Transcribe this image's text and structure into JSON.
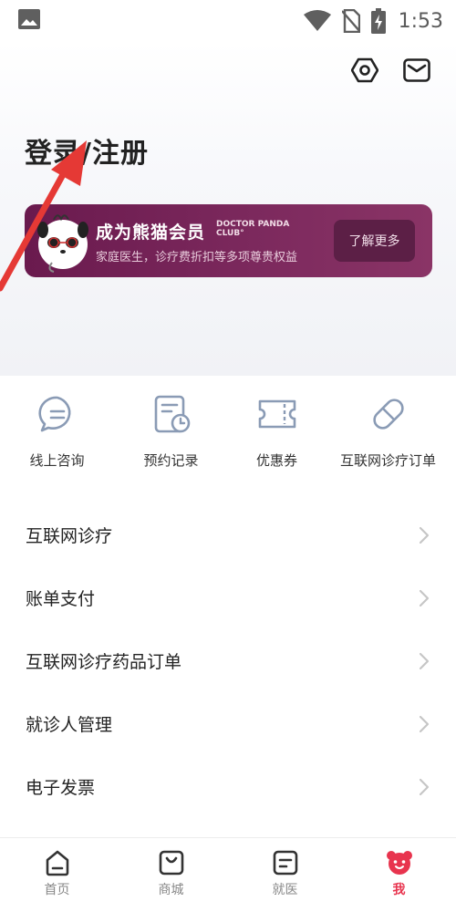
{
  "status_bar": {
    "time": "1:53"
  },
  "header": {
    "login_title": "登录/注册"
  },
  "vip_card": {
    "title": "成为熊猫会员",
    "brand_line1": "DOCTOR PANDA",
    "brand_line2": "CLUB°",
    "subtitle": "家庭医生，诊疗费折扣等多项尊贵权益",
    "button": "了解更多"
  },
  "quick_actions": [
    {
      "label": "线上咨询",
      "icon": "chat-icon"
    },
    {
      "label": "预约记录",
      "icon": "appointment-record-icon"
    },
    {
      "label": "优惠券",
      "icon": "coupon-icon"
    },
    {
      "label": "互联网诊疗订单",
      "icon": "pill-icon"
    }
  ],
  "menu": [
    {
      "label": "互联网诊疗"
    },
    {
      "label": "账单支付"
    },
    {
      "label": "互联网诊疗药品订单"
    },
    {
      "label": "就诊人管理"
    },
    {
      "label": "电子发票"
    }
  ],
  "bottom_nav": [
    {
      "label": "首页",
      "icon": "home-icon"
    },
    {
      "label": "商城",
      "icon": "shop-bag-icon"
    },
    {
      "label": "就医",
      "icon": "medical-list-icon"
    },
    {
      "label": "我",
      "icon": "panda-me-icon",
      "active": true
    }
  ],
  "colors": {
    "accent": "#e8344e",
    "vip_bg": "#7d2a5e",
    "arrow": "#e53935"
  }
}
